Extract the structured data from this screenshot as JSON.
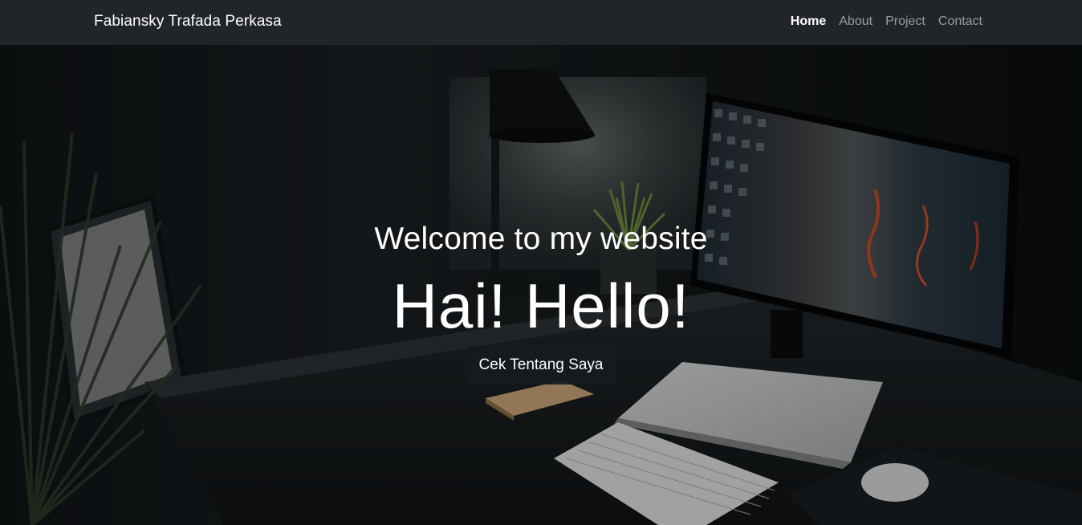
{
  "navbar": {
    "brand": "Fabiansky Trafada Perkasa",
    "links": [
      {
        "label": "Home",
        "active": true
      },
      {
        "label": "About",
        "active": false
      },
      {
        "label": "Project",
        "active": false
      },
      {
        "label": "Contact",
        "active": false
      }
    ]
  },
  "hero": {
    "subtitle": "Welcome to my website",
    "headline": "Hai! Hello!",
    "cta_label": "Cek Tentang Saya"
  },
  "colors": {
    "navbar_bg": "#212529",
    "text_primary": "#ffffff",
    "text_muted": "#9a9da0"
  }
}
